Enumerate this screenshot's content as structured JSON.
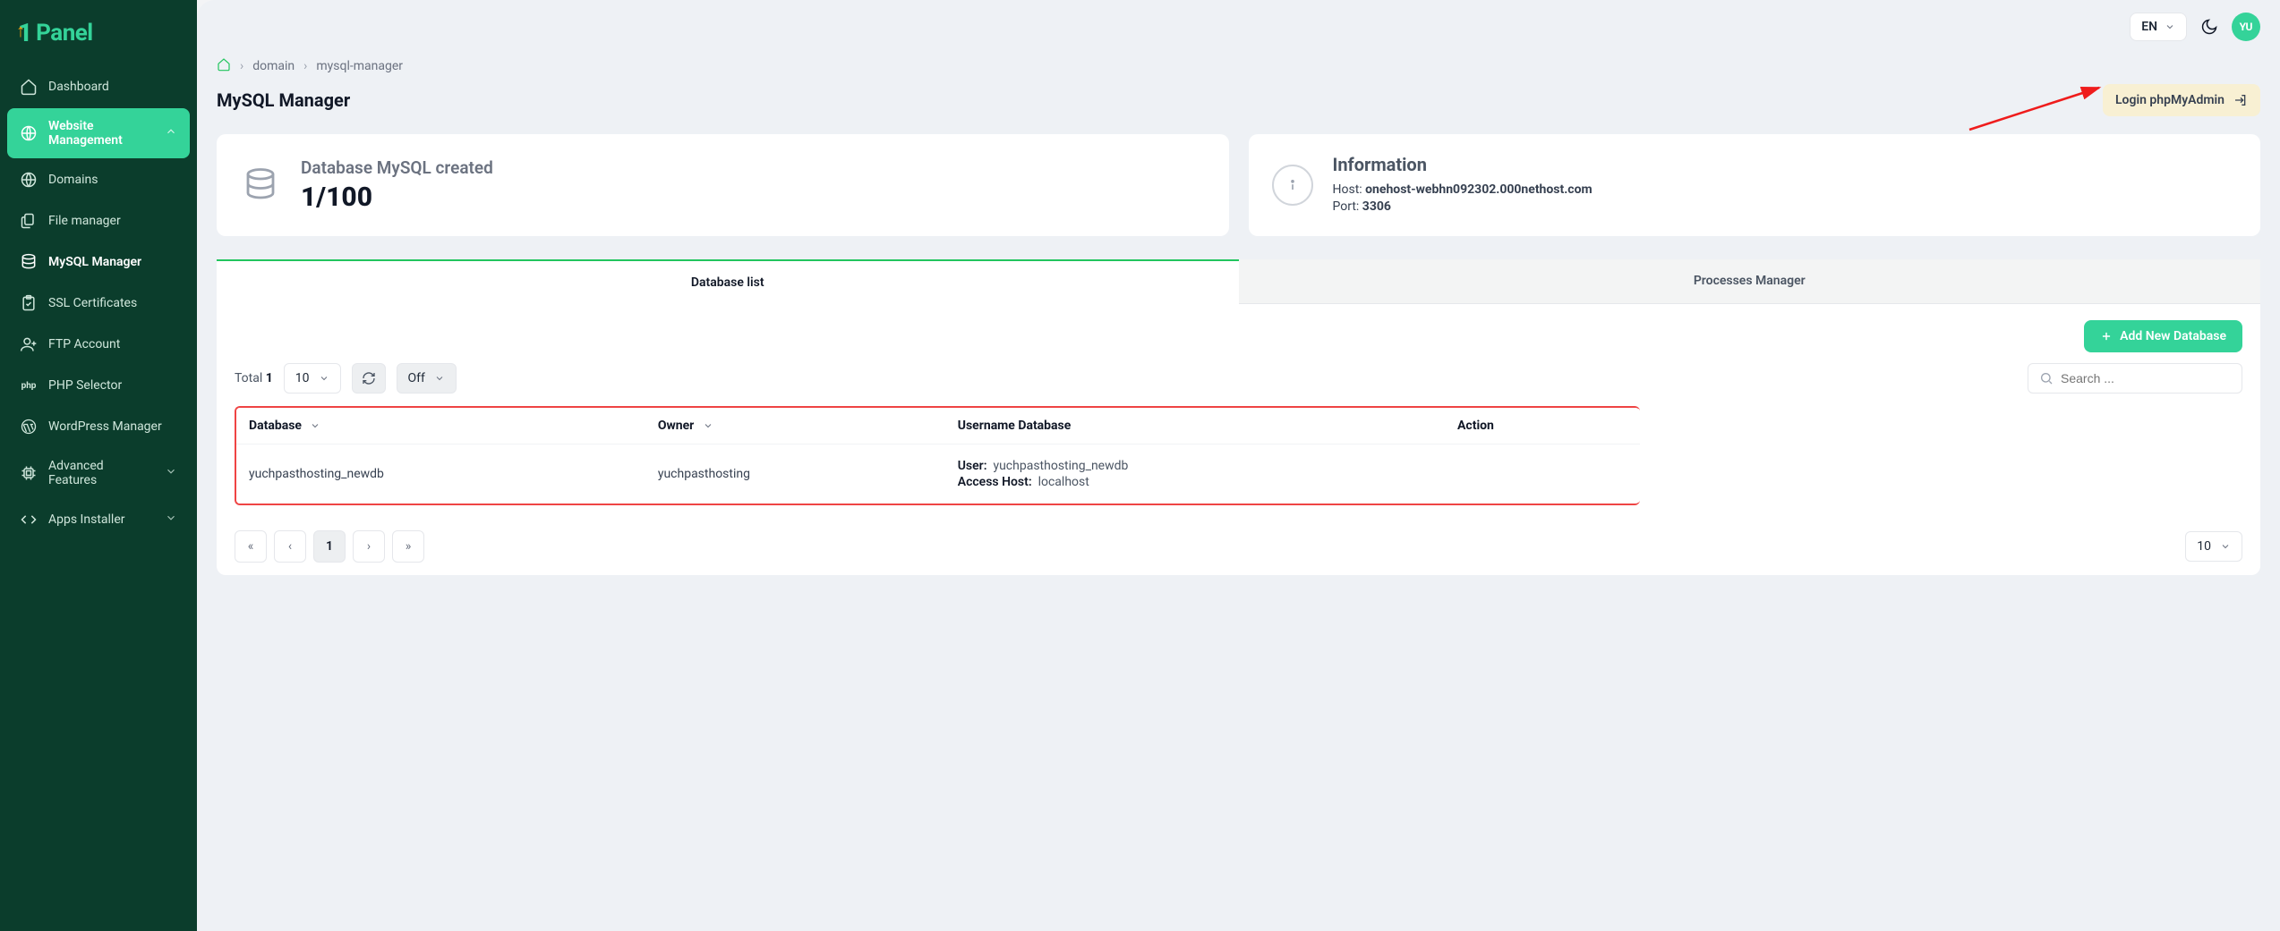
{
  "brand": {
    "name": "Panel"
  },
  "topbar": {
    "language": "EN",
    "avatar_initials": "YU"
  },
  "sidebar": {
    "items": [
      {
        "label": "Dashboard"
      },
      {
        "label": "Website Management"
      },
      {
        "label": "Domains"
      },
      {
        "label": "File manager"
      },
      {
        "label": "MySQL Manager"
      },
      {
        "label": "SSL Certificates"
      },
      {
        "label": "FTP Account"
      },
      {
        "label": "PHP Selector"
      },
      {
        "label": "WordPress Manager"
      },
      {
        "label": "Advanced Features"
      },
      {
        "label": "Apps Installer"
      }
    ]
  },
  "breadcrumb": {
    "parent": "domain",
    "current": "mysql-manager"
  },
  "page": {
    "title": "MySQL Manager",
    "login_pma_label": "Login phpMyAdmin"
  },
  "stats": {
    "created_label": "Database MySQL created",
    "created_value": "1/100",
    "info_title": "Information",
    "host_label": "Host:",
    "host_value": "onehost-webhn092302.000nethost.com",
    "port_label": "Port:",
    "port_value": "3306"
  },
  "tabs": {
    "list": "Database list",
    "processes": "Processes Manager"
  },
  "toolbar": {
    "add_label": "Add New Database"
  },
  "controls": {
    "total_label": "Total",
    "total_value": "1",
    "page_size": "10",
    "autorefresh": "Off",
    "search_placeholder": "Search ..."
  },
  "table": {
    "headers": {
      "database": "Database",
      "owner": "Owner",
      "username_db": "Username Database",
      "action": "Action"
    },
    "row": {
      "database": "yuchpasthosting_newdb",
      "owner": "yuchpasthosting",
      "user_label": "User:",
      "user_value": "yuchpasthosting_newdb",
      "access_host_label": "Access Host:",
      "access_host_value": "localhost"
    }
  },
  "pager": {
    "current": "1",
    "perpage": "10"
  }
}
